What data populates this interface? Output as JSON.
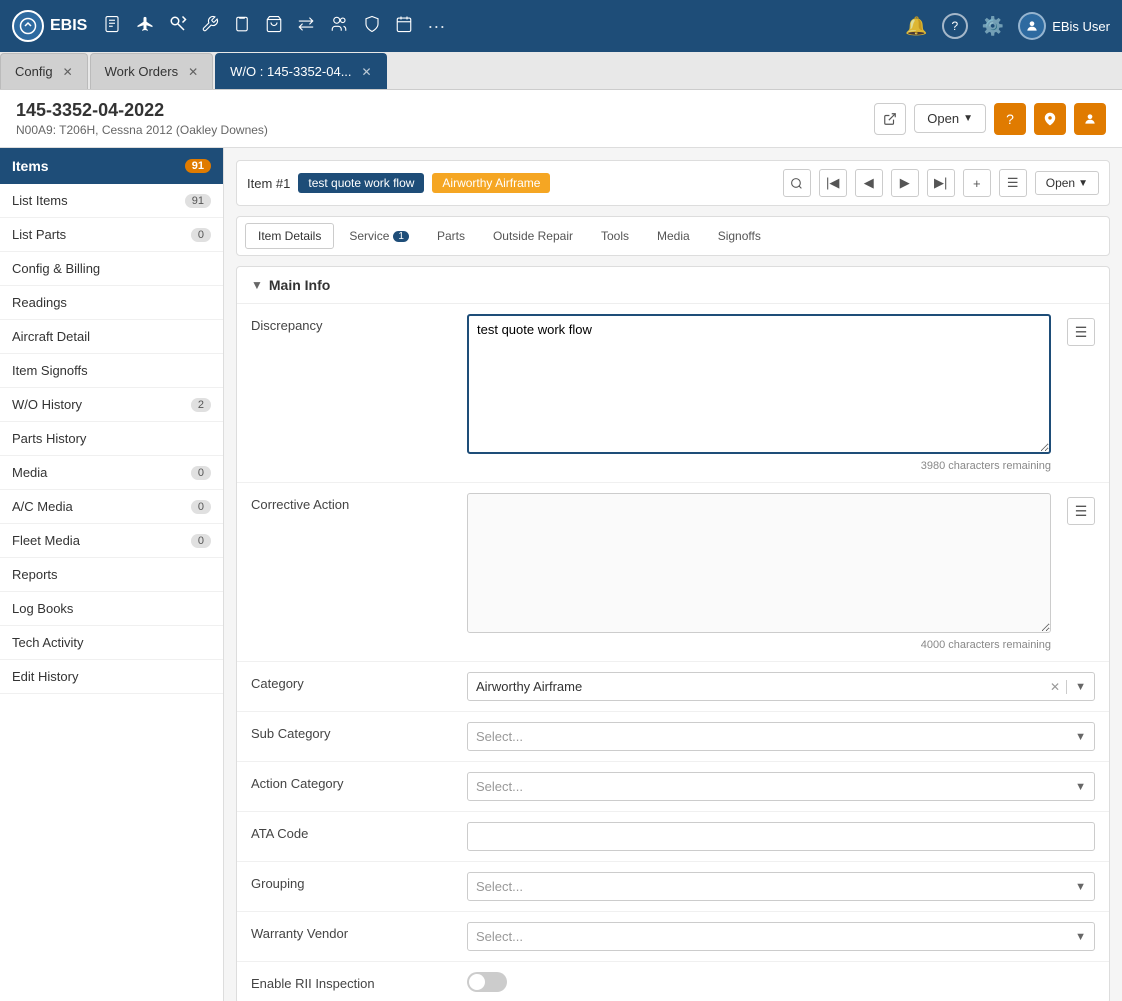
{
  "app": {
    "name": "EBIS",
    "logo_text": "EBIS"
  },
  "nav_icons": [
    "📋",
    "✈️",
    "☕",
    "🔧",
    "📋",
    "🛒",
    "⇄",
    "👥",
    "🛡️",
    "📅"
  ],
  "top_right": {
    "bell_icon": "🔔",
    "help_icon": "?",
    "settings_icon": "⚙️",
    "user_icon": "👤",
    "user_label": "EBis User"
  },
  "tabs": [
    {
      "id": "config",
      "label": "Config",
      "active": false,
      "closable": true
    },
    {
      "id": "work-orders",
      "label": "Work Orders",
      "active": false,
      "closable": true
    },
    {
      "id": "wo-detail",
      "label": "W/O : 145-3352-04...",
      "active": true,
      "closable": true
    }
  ],
  "page": {
    "title": "145-3352-04-2022",
    "subtitle": "N00A9: T206H, Cessna 2012 (Oakley Downes)",
    "open_label": "Open",
    "external_link_icon": "⬡",
    "help_btn_icon": "?",
    "pin_btn_icon": "📌",
    "user_btn_icon": "👤"
  },
  "sidebar": {
    "header_label": "Items",
    "header_badge": "91",
    "items": [
      {
        "label": "List Items",
        "badge": "91",
        "has_badge": true
      },
      {
        "label": "List Parts",
        "badge": "0",
        "has_badge": true
      },
      {
        "label": "Config & Billing",
        "badge": null,
        "has_badge": false
      },
      {
        "label": "Readings",
        "badge": null,
        "has_badge": false
      },
      {
        "label": "Aircraft Detail",
        "badge": null,
        "has_badge": false
      },
      {
        "label": "Item Signoffs",
        "badge": null,
        "has_badge": false
      },
      {
        "label": "W/O History",
        "badge": "2",
        "has_badge": true
      },
      {
        "label": "Parts History",
        "badge": null,
        "has_badge": false
      },
      {
        "label": "Media",
        "badge": "0",
        "has_badge": true
      },
      {
        "label": "A/C Media",
        "badge": "0",
        "has_badge": true
      },
      {
        "label": "Fleet Media",
        "badge": "0",
        "has_badge": true
      },
      {
        "label": "Reports",
        "badge": null,
        "has_badge": false
      },
      {
        "label": "Log Books",
        "badge": null,
        "has_badge": false
      },
      {
        "label": "Tech Activity",
        "badge": null,
        "has_badge": false
      },
      {
        "label": "Edit History",
        "badge": null,
        "has_badge": false
      }
    ]
  },
  "item_toolbar": {
    "item_label": "Item #1",
    "tag1": "test quote work flow",
    "tag2": "Airworthy Airframe",
    "open_label": "Open"
  },
  "sub_tabs": [
    {
      "id": "item-details",
      "label": "Item Details",
      "active": true,
      "badge": null
    },
    {
      "id": "service",
      "label": "Service",
      "active": false,
      "badge": "1"
    },
    {
      "id": "parts",
      "label": "Parts",
      "active": false,
      "badge": null
    },
    {
      "id": "outside-repair",
      "label": "Outside Repair",
      "active": false,
      "badge": null
    },
    {
      "id": "tools",
      "label": "Tools",
      "active": false,
      "badge": null
    },
    {
      "id": "media",
      "label": "Media",
      "active": false,
      "badge": null
    },
    {
      "id": "signoffs",
      "label": "Signoffs",
      "active": false,
      "badge": null
    }
  ],
  "main_info": {
    "section_title": "Main Info",
    "discrepancy_label": "Discrepancy",
    "discrepancy_value": "test quote work flow",
    "discrepancy_chars_remaining": "3980 characters remaining",
    "corrective_action_label": "Corrective Action",
    "corrective_action_value": "",
    "corrective_action_chars_remaining": "4000 characters remaining",
    "category_label": "Category",
    "category_value": "Airworthy Airframe",
    "sub_category_label": "Sub Category",
    "sub_category_placeholder": "Select...",
    "action_category_label": "Action Category",
    "action_category_placeholder": "Select...",
    "ata_code_label": "ATA Code",
    "ata_code_value": "",
    "grouping_label": "Grouping",
    "grouping_placeholder": "Select...",
    "warranty_vendor_label": "Warranty Vendor",
    "warranty_vendor_placeholder": "Select...",
    "enable_rii_label": "Enable RII Inspection"
  }
}
